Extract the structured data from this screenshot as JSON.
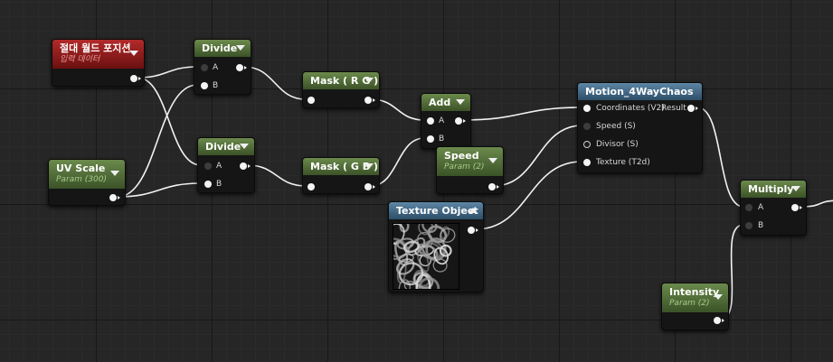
{
  "nodes": {
    "abs_world_pos": {
      "title": "절대 월드 포지션",
      "subtitle": "입력 데이터"
    },
    "uv_scale": {
      "title": "UV Scale",
      "subtitle": "Param (300)"
    },
    "divide1": {
      "title": "Divide",
      "pin_a": "A",
      "pin_b": "B"
    },
    "divide2": {
      "title": "Divide",
      "pin_a": "A",
      "pin_b": "B"
    },
    "mask_rg": {
      "title": "Mask ( R G )"
    },
    "mask_gb": {
      "title": "Mask ( G B )"
    },
    "add": {
      "title": "Add",
      "pin_a": "A",
      "pin_b": "B"
    },
    "speed": {
      "title": "Speed",
      "subtitle": "Param (2)"
    },
    "texture_object": {
      "title": "Texture Object"
    },
    "motion": {
      "title": "Motion_4WayChaos",
      "in_coordinates": "Coordinates (V2)",
      "in_speed": "Speed (S)",
      "in_divisor": "Divisor (S)",
      "in_texture": "Texture (T2d)",
      "out_result": "Result"
    },
    "multiply": {
      "title": "Multiply",
      "pin_a": "A",
      "pin_b": "B"
    },
    "intensity": {
      "title": "Intensity",
      "subtitle": "Param (2)"
    }
  },
  "icons": {
    "node_menu": "dropdown-arrow-icon",
    "texture_menu": "collapse-arrow-icon",
    "pin": "pin-connector-icon"
  },
  "colors": {
    "canvas_bg": "#262626",
    "header_green": "#55703b",
    "header_blue": "#46708f",
    "header_red": "#8e1b1b",
    "node_body": "#151515",
    "wire": "#f2f2f2"
  }
}
